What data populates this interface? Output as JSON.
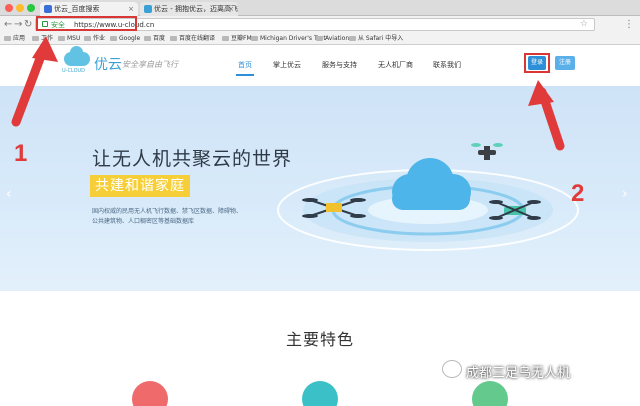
{
  "browser": {
    "tabs": [
      {
        "title": "优云_百度搜索",
        "favicon_color": "#3a6fd8"
      },
      {
        "title": "优云 - 拥抱优云，迈离高飞 | 优云科技",
        "favicon_color": "#3aa1d6"
      }
    ],
    "url": {
      "secure_label": "安全",
      "address": "https://www.u-cloud.cn"
    },
    "bookmarks": [
      "应用",
      "工作",
      "MSU",
      "作业",
      "Google",
      "百度",
      "百度在线翻译",
      "豆瓣FM",
      "Michigan Driver's Test",
      "Aviation",
      "从 Safari 中导入"
    ]
  },
  "site": {
    "logo_name": "优云",
    "logo_sub": "U-CLOUD",
    "slogan": "安全享自由飞行",
    "nav": [
      "首页",
      "掌上优云",
      "服务与支持",
      "无人机厂商",
      "联系我们"
    ],
    "login_label": "登录",
    "register_label": "注册"
  },
  "hero": {
    "title": "让无人机共聚云的世界",
    "badge": "共建和谐家庭",
    "description": "国内权威的民用无人机飞行数据、禁飞区数据、障碍物、公共建筑物、人口稠密区等基础数据库"
  },
  "features": {
    "title": "主要特色"
  },
  "annotations": {
    "step1": "1",
    "step2": "2"
  },
  "watermark": "成都三足乌无人机",
  "colors": {
    "accent": "#2d8fd8",
    "badge": "#f6cf38",
    "annotation": "#e03a3a"
  }
}
